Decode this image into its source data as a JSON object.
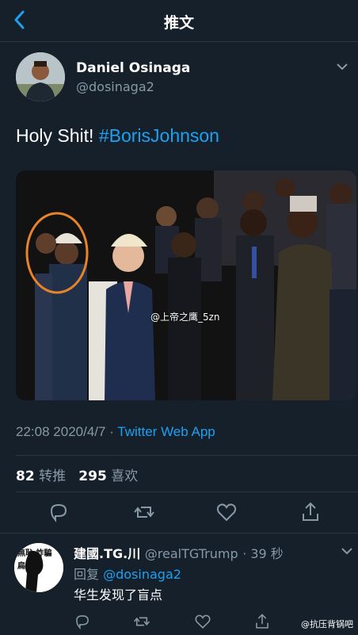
{
  "header": {
    "title": "推文"
  },
  "author": {
    "name": "Daniel Osinaga",
    "handle": "@dosinaga2"
  },
  "tweet": {
    "text": "Holy Shit! ",
    "hashtag": "#BorisJohnson",
    "photo_watermark": "@上帝之鹰_5zn"
  },
  "meta": {
    "time": "22:08",
    "date": "2020/4/7",
    "separator": " · ",
    "source": "Twitter Web App"
  },
  "stats": {
    "retweets": "82",
    "retweets_label": "转推",
    "likes": "295",
    "likes_label": "喜欢"
  },
  "reply": {
    "name": "建國.TG.川",
    "handle": "@realTGTrump",
    "time": "· 39 秒",
    "replying_label": "回复",
    "replying_to": "@dosinaga2",
    "text": "华生发现了盲点",
    "avatar_text": "無恥 詐騙 扁"
  },
  "watermark_bottom": "@抗压背锅吧",
  "colors": {
    "background": "#15202b",
    "accent": "#1da1f2",
    "muted": "#8899a6"
  },
  "icons": [
    "back-arrow-icon",
    "chevron-down-icon",
    "reply-icon",
    "retweet-icon",
    "like-icon",
    "share-icon"
  ]
}
